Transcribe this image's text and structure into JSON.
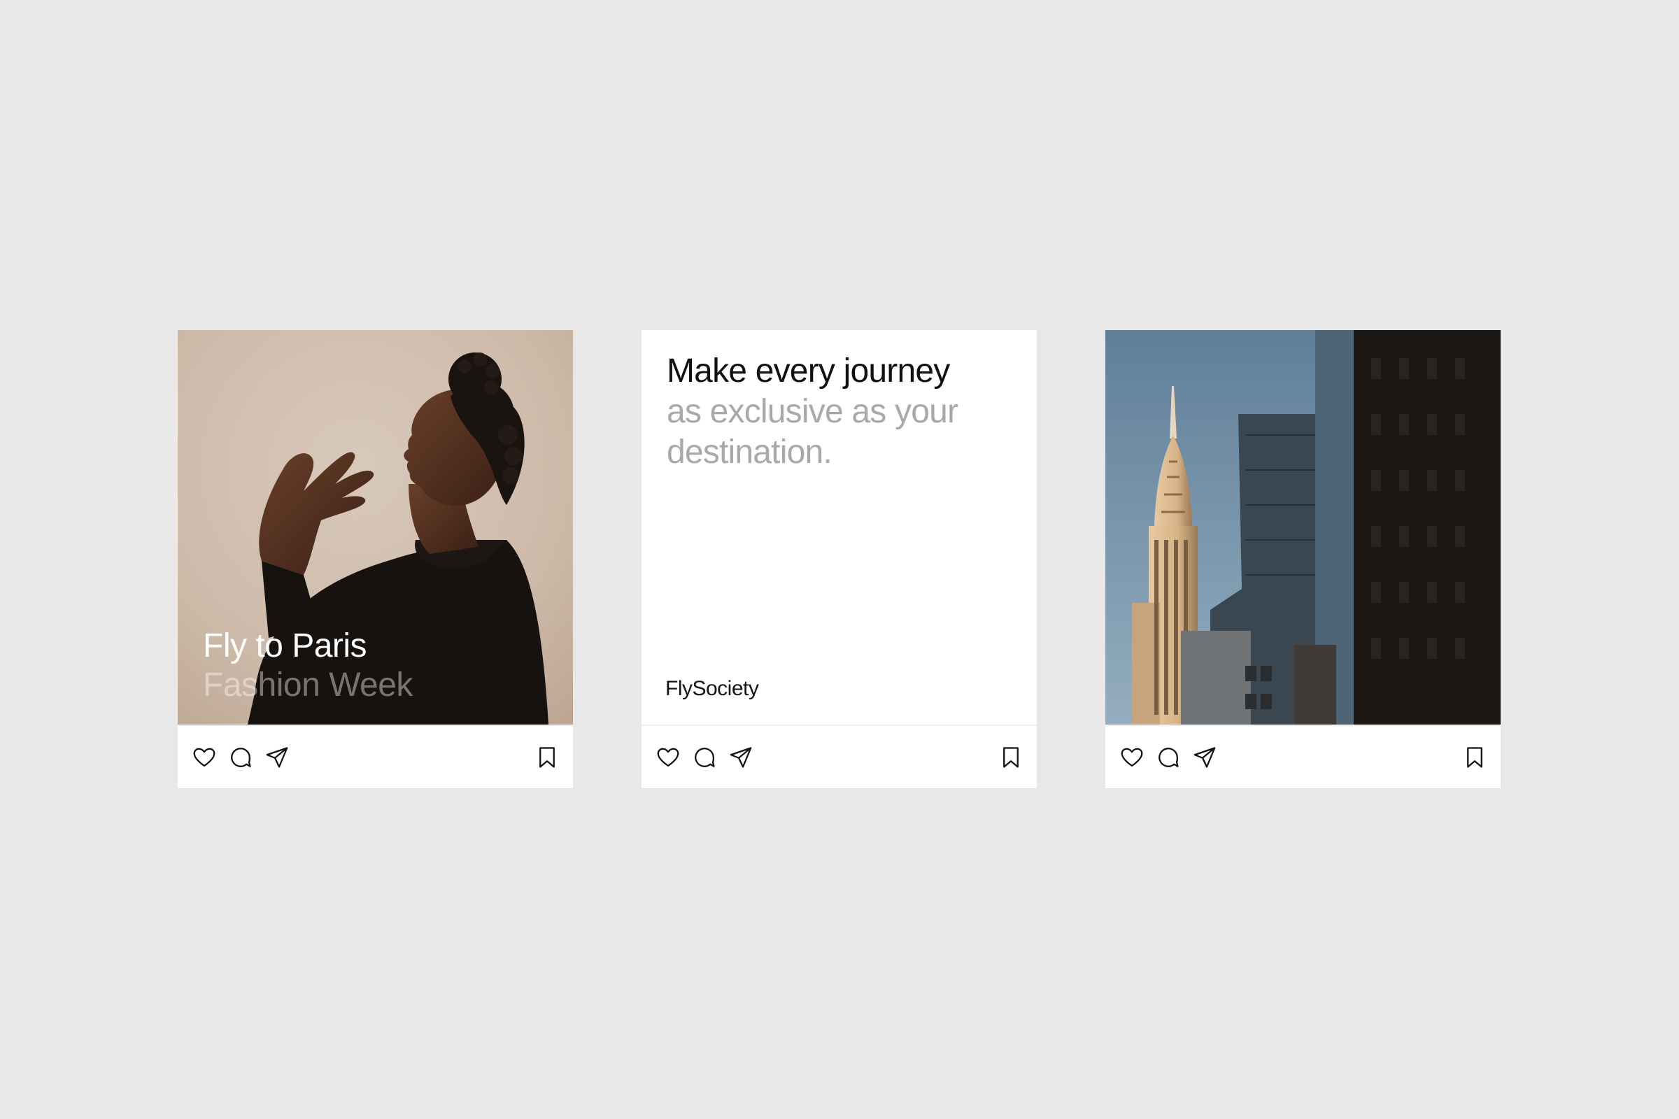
{
  "posts": [
    {
      "image": "portrait of woman with braided bun gesturing with hands against beige backdrop",
      "overlay": {
        "line1": "Fly to Paris",
        "line2": "Fashion Week"
      }
    },
    {
      "headline": {
        "line1": "Make every journey",
        "line2": "as exclusive as your",
        "line3": "destination."
      },
      "brand": "FlySociety"
    },
    {
      "image": "art deco skyscraper spire against blue sky beside dark buildings"
    }
  ],
  "actions": {
    "like_icon": "heart-icon",
    "comment_icon": "comment-bubble-icon",
    "share_icon": "paper-plane-icon",
    "save_icon": "bookmark-icon"
  },
  "colors": {
    "background": "#e8e8e8",
    "card": "#ffffff",
    "headline_dark": "#111111",
    "headline_light": "#a9a9a9"
  }
}
